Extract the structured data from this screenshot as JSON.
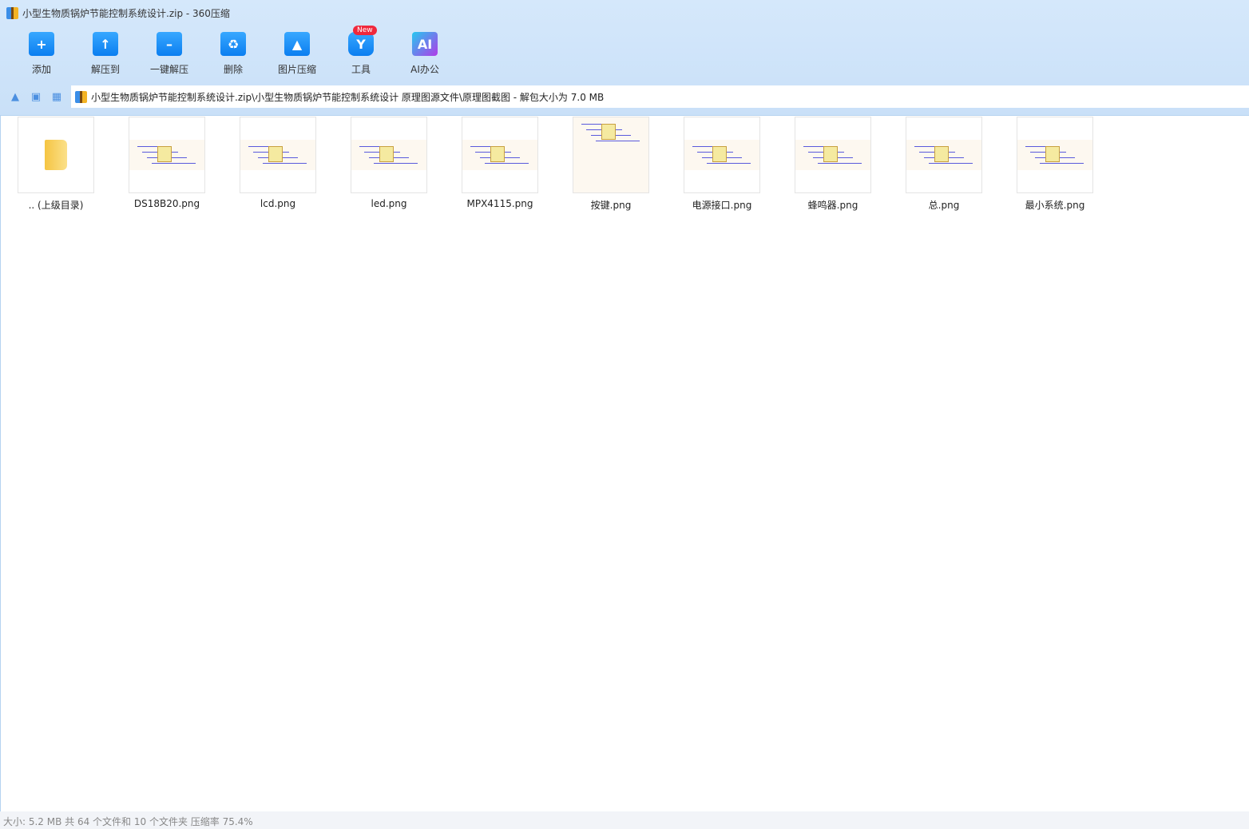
{
  "window": {
    "title": "小型生物质锅炉节能控制系统设计.zip - 360压缩"
  },
  "toolbar": [
    {
      "label": "添加",
      "icon": "add-icon",
      "glyph": "+"
    },
    {
      "label": "解压到",
      "icon": "extract-to-icon",
      "glyph": "↑"
    },
    {
      "label": "一键解压",
      "icon": "one-click-extract-icon",
      "glyph": "–"
    },
    {
      "label": "删除",
      "icon": "delete-icon",
      "glyph": "♻"
    },
    {
      "label": "图片压缩",
      "icon": "image-compress-icon",
      "glyph": "▲"
    },
    {
      "label": "工具",
      "icon": "tools-icon",
      "glyph": "Y"
    },
    {
      "label": "AI办公",
      "icon": "ai-office-icon",
      "glyph": "AI"
    }
  ],
  "new_badge": "New",
  "address": "小型生物质锅炉节能控制系统设计.zip\\小型生物质锅炉节能控制系统设计 原理图源文件\\原理图截图 - 解包大小为 7.0 MB",
  "files": [
    {
      "name": ".. (上级目录)",
      "type": "folder"
    },
    {
      "name": "DS18B20.png",
      "type": "image"
    },
    {
      "name": "lcd.png",
      "type": "image"
    },
    {
      "name": "led.png",
      "type": "image"
    },
    {
      "name": "MPX4115.png",
      "type": "image"
    },
    {
      "name": "按键.png",
      "type": "image"
    },
    {
      "name": "电源接口.png",
      "type": "image"
    },
    {
      "name": "蜂鸣器.png",
      "type": "image"
    },
    {
      "name": "总.png",
      "type": "image"
    },
    {
      "name": "最小系统.png",
      "type": "image"
    }
  ],
  "status": "大小: 5.2 MB 共 64 个文件和 10 个文件夹 压缩率 75.4%"
}
